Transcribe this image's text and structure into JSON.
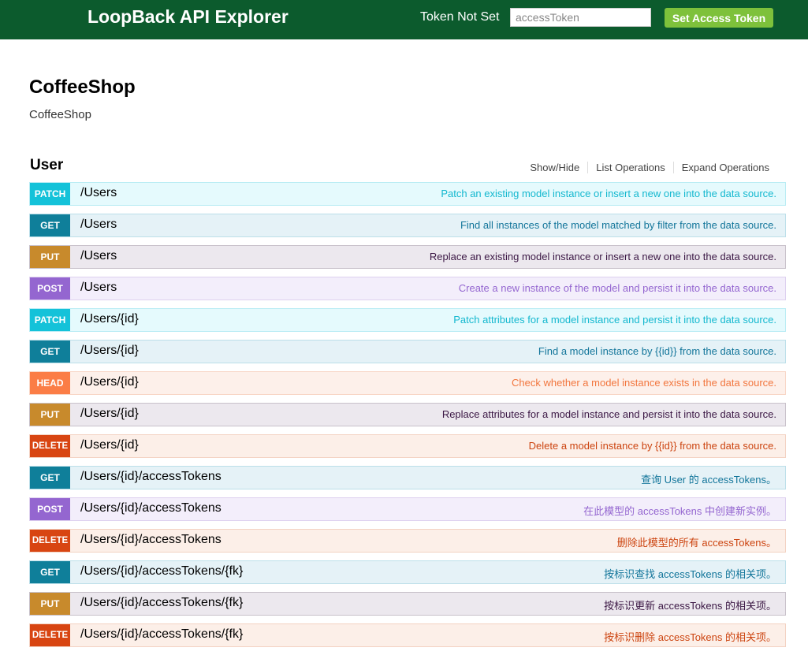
{
  "header": {
    "brand": "LoopBack API Explorer",
    "token_status": "Token Not Set",
    "token_placeholder": "accessToken",
    "token_value": "",
    "set_token_label": "Set Access Token"
  },
  "api": {
    "title": "CoffeeShop",
    "description": "CoffeeShop"
  },
  "resource": {
    "name": "User",
    "links": [
      "Show/Hide",
      "List Operations",
      "Expand Operations"
    ]
  },
  "operations": [
    {
      "method": "PATCH",
      "path": "/Users",
      "summary": "Patch an existing model instance or insert a new one into the data source."
    },
    {
      "method": "GET",
      "path": "/Users",
      "summary": "Find all instances of the model matched by filter from the data source."
    },
    {
      "method": "PUT",
      "path": "/Users",
      "summary": "Replace an existing model instance or insert a new one into the data source."
    },
    {
      "method": "POST",
      "path": "/Users",
      "summary": "Create a new instance of the model and persist it into the data source."
    },
    {
      "method": "PATCH",
      "path": "/Users/{id}",
      "summary": "Patch attributes for a model instance and persist it into the data source."
    },
    {
      "method": "GET",
      "path": "/Users/{id}",
      "summary": "Find a model instance by {{id}} from the data source."
    },
    {
      "method": "HEAD",
      "path": "/Users/{id}",
      "summary": "Check whether a model instance exists in the data source."
    },
    {
      "method": "PUT",
      "path": "/Users/{id}",
      "summary": "Replace attributes for a model instance and persist it into the data source."
    },
    {
      "method": "DELETE",
      "path": "/Users/{id}",
      "summary": "Delete a model instance by {{id}} from the data source."
    },
    {
      "method": "GET",
      "path": "/Users/{id}/accessTokens",
      "summary": "查询 User 的 accessTokens。"
    },
    {
      "method": "POST",
      "path": "/Users/{id}/accessTokens",
      "summary": "在此模型的 accessTokens 中创建新实例。"
    },
    {
      "method": "DELETE",
      "path": "/Users/{id}/accessTokens",
      "summary": "删除此模型的所有 accessTokens。"
    },
    {
      "method": "GET",
      "path": "/Users/{id}/accessTokens/{fk}",
      "summary": "按标识查找 accessTokens 的相关项。"
    },
    {
      "method": "PUT",
      "path": "/Users/{id}/accessTokens/{fk}",
      "summary": "按标识更新 accessTokens 的相关项。"
    },
    {
      "method": "DELETE",
      "path": "/Users/{id}/accessTokens/{fk}",
      "summary": "按标识删除 accessTokens 的相关项。"
    }
  ],
  "colors": {
    "topbar": "#0c5b2d",
    "set_token_button": "#7ec13b",
    "method_patch": "#14c2d9",
    "method_get": "#0f7f9a",
    "method_put": "#c88a2c",
    "method_post": "#9466d0",
    "method_head": "#fb7d46",
    "method_delete": "#d84512"
  }
}
